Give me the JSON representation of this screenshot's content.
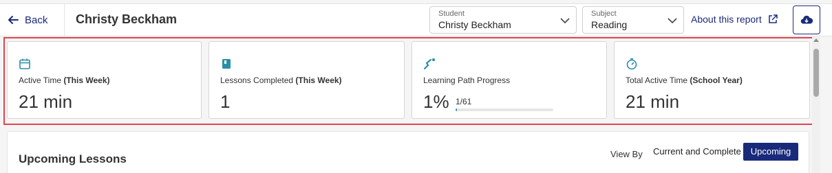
{
  "header": {
    "back_label": "Back",
    "page_title": "Christy Beckham",
    "student_select": {
      "label": "Student",
      "value": "Christy Beckham"
    },
    "subject_select": {
      "label": "Subject",
      "value": "Reading"
    },
    "about_label": "About this report"
  },
  "stats": [
    {
      "icon": "calendar-icon",
      "label": "Active Time ",
      "label_bold": "(This Week)",
      "value": "21 min"
    },
    {
      "icon": "book-icon",
      "label": "Lessons Completed ",
      "label_bold": "(This Week)",
      "value": "1"
    },
    {
      "icon": "path-icon",
      "label": "Learning Path Progress",
      "label_bold": "",
      "value": "1%",
      "progress_text": "1/61",
      "progress_fraction": 0.016
    },
    {
      "icon": "timer-icon",
      "label": "Total Active Time ",
      "label_bold": "(School Year)",
      "value": "21 min"
    }
  ],
  "lessons": {
    "title": "Upcoming Lessons",
    "view_by_label": "View By",
    "options": [
      "Current and Complete",
      "Upcoming"
    ],
    "selected": "Upcoming"
  },
  "colors": {
    "accent": "#1a2a7a",
    "icon_teal": "#2a8fa6",
    "highlight": "#e0434b"
  }
}
